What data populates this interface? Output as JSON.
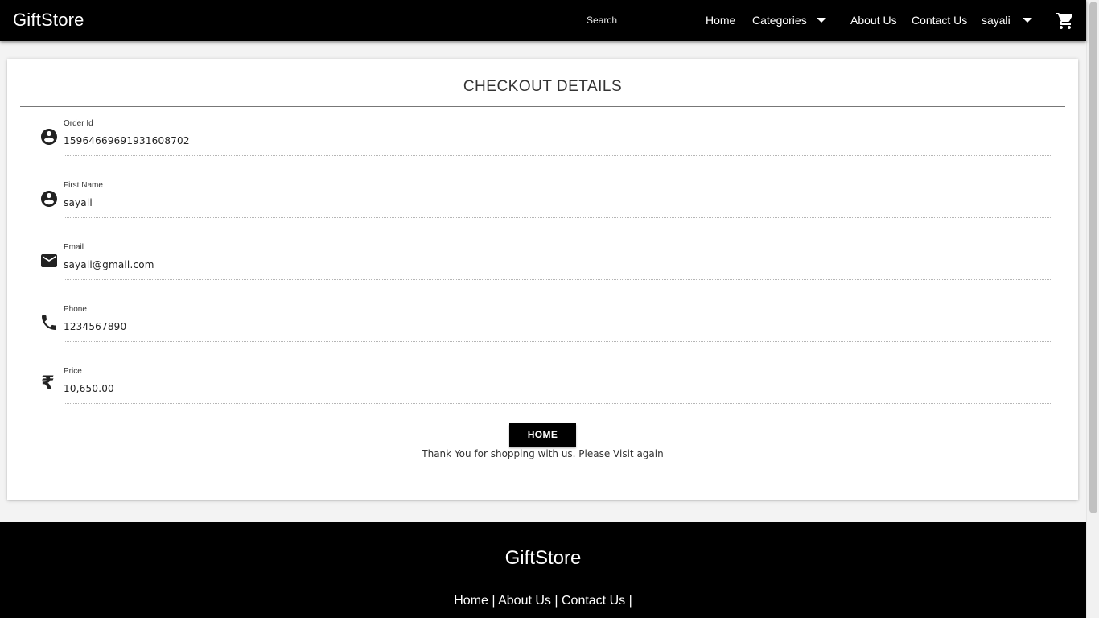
{
  "header": {
    "brand": "GiftStore",
    "search": {
      "placeholder": "Search",
      "value": ""
    },
    "nav": {
      "home": "Home",
      "categories": "Categories",
      "about": "About Us",
      "contact": "Contact Us",
      "user": "sayali"
    },
    "cart_icon": "shopping-cart-icon"
  },
  "checkout": {
    "title": "CHECKOUT DETAILS",
    "fields": [
      {
        "label": "Order Id",
        "value": "15964669691931608702",
        "icon": "account-circle-icon"
      },
      {
        "label": "First Name",
        "value": "sayali",
        "icon": "account-circle-icon"
      },
      {
        "label": "Email",
        "value": "sayali@gmail.com",
        "icon": "email-icon"
      },
      {
        "label": "Phone",
        "value": "1234567890",
        "icon": "phone-icon"
      },
      {
        "label": "Price",
        "value": "10,650.00",
        "icon": "rupee-icon"
      }
    ],
    "rupee_symbol": "₹",
    "home_button": "HOME",
    "thanks": "Thank You for shopping with us. Please Visit again"
  },
  "footer": {
    "brand": "GiftStore",
    "links": [
      "Home",
      "About Us",
      "Contact Us"
    ],
    "separator": "|"
  },
  "colors": {
    "header_bg": "#000000",
    "footer_bg": "#000000",
    "page_bg": "#f3f3f3",
    "button_bg": "#000000"
  }
}
